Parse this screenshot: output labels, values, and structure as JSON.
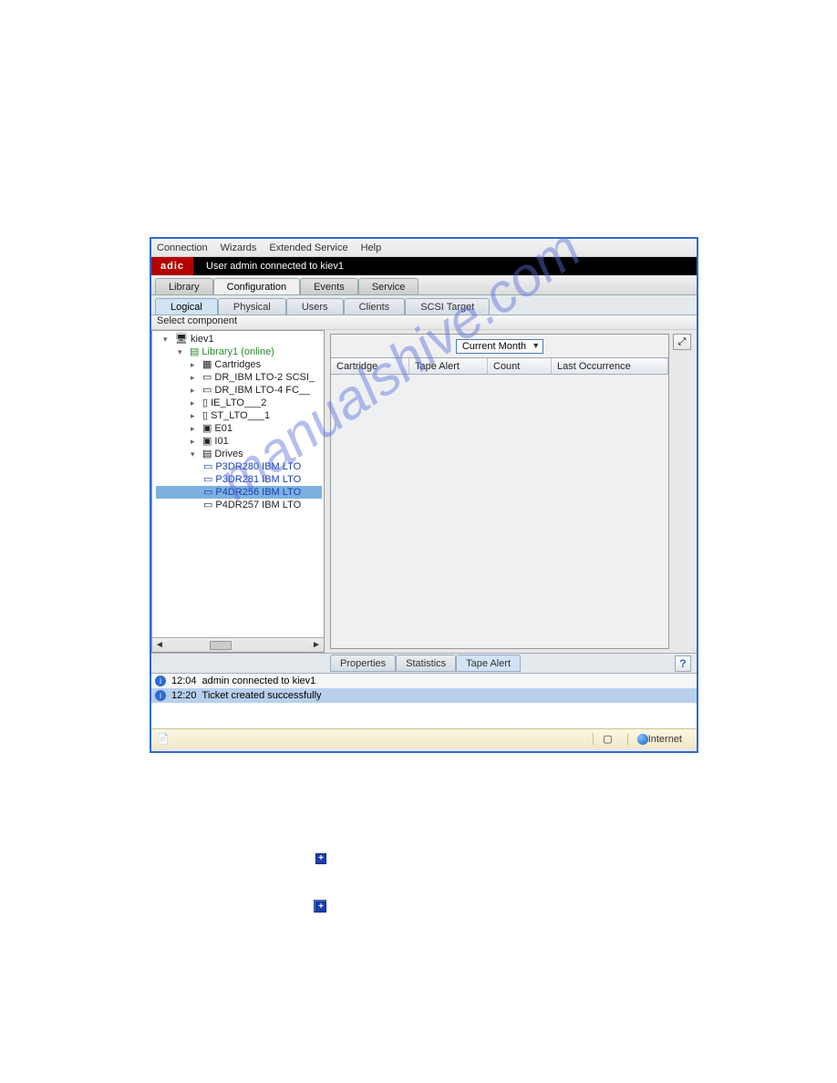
{
  "link_above": "",
  "menubar": {
    "connection": "Connection",
    "wizards": "Wizards",
    "extended": "Extended Service",
    "help": "Help"
  },
  "blackbar": {
    "brand": "adic",
    "message": "User admin connected to kiev1"
  },
  "outer_tabs": [
    "Library",
    "Configuration",
    "Events",
    "Service"
  ],
  "inner_tabs": [
    "Logical",
    "Physical",
    "Users",
    "Clients",
    "SCSI Target"
  ],
  "select_component": "Select component",
  "tree": {
    "root": "kiev1",
    "library": "Library1 (online)",
    "items": [
      "Cartridges",
      "DR_IBM LTO-2 SCSI_",
      "DR_IBM LTO-4 FC__",
      "IE_LTO___2",
      "ST_LTO___1",
      "E01",
      "I01",
      "Drives"
    ],
    "drives": [
      "P3DR280 IBM LTO",
      "P3DR281 IBM LTO",
      "P4DR256 IBM LTO",
      "P4DR257 IBM LTO"
    ]
  },
  "dropdown": {
    "value": "Current Month"
  },
  "grid_headers": [
    "Cartridge",
    "Tape Alert",
    "Count",
    "Last Occurrence"
  ],
  "bottom_tabs": [
    "Properties",
    "Statistics",
    "Tape Alert"
  ],
  "log": [
    {
      "time": "12:04",
      "text": "admin connected to kiev1"
    },
    {
      "time": "12:20",
      "text": "Ticket created successfully"
    }
  ],
  "statusbar": {
    "zone": "Internet"
  },
  "help_q": "?",
  "watermark": "manualshive.com"
}
